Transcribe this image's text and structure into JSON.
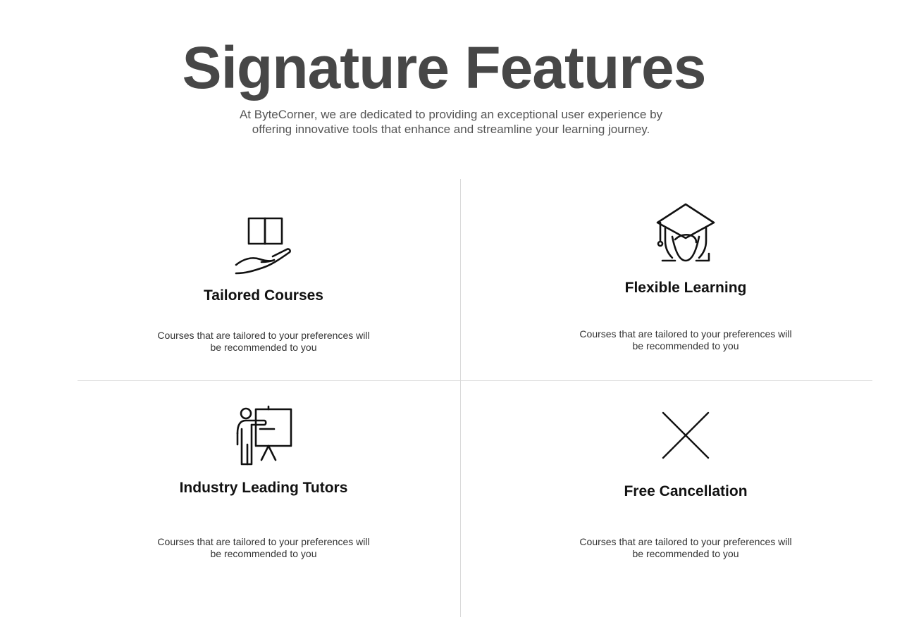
{
  "header": {
    "title": "Signature Features",
    "subtitle": "At ByteCorner, we are dedicated to providing an exceptional user experience by offering innovative tools that enhance and streamline your learning journey."
  },
  "features": [
    {
      "icon": "book-in-hand-icon",
      "title": "Tailored Courses",
      "description": "Courses that are tailored to your preferences will be recommended to you"
    },
    {
      "icon": "graduate-cap-icon",
      "title": "Flexible Learning",
      "description": "Courses that are tailored to your preferences will be recommended to you"
    },
    {
      "icon": "teacher-board-icon",
      "title": "Industry Leading Tutors",
      "description": "Courses that are tailored to your preferences will be recommended to you"
    },
    {
      "icon": "x-cross-icon",
      "title": "Free Cancellation",
      "description": "Courses that are tailored to your preferences will be recommended to you"
    }
  ],
  "colors": {
    "title": "#474747",
    "text": "#111111",
    "divider": "#d9d9d9"
  }
}
